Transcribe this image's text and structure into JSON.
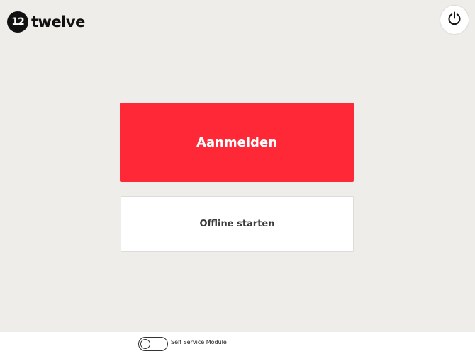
{
  "brand": {
    "mark_text": "12",
    "name": "twelve"
  },
  "header": {
    "power_icon": "power-icon"
  },
  "main": {
    "login_label": "Aanmelden",
    "offline_label": "Offline starten",
    "login_color": "#fe2837"
  },
  "footer": {
    "toggle_label": "Self Service Module",
    "toggle_on": false
  }
}
